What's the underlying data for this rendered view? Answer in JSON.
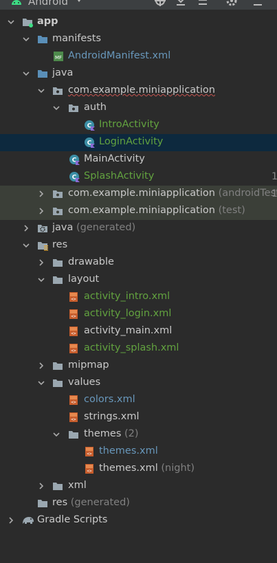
{
  "toolbar": {
    "view_name": "Android",
    "icons": [
      "android-icon",
      "locate-icon",
      "collapse-all-icon",
      "expand-all-icon",
      "gear-icon",
      "hide-icon"
    ]
  },
  "tree": {
    "app": "app",
    "manifests": "manifests",
    "android_manifest": "AndroidManifest.xml",
    "java": "java",
    "package_main": "com.example.miniapplication",
    "auth": "auth",
    "intro_activity": "IntroActivity",
    "login_activity": "LoginActivity",
    "main_activity": "MainActivity",
    "splash_activity": "SplashActivity",
    "package_android_test": "com.example.miniapplication",
    "android_test_hint": "(androidTest",
    "package_test": "com.example.miniapplication",
    "test_hint": "(test)",
    "java_generated": "java",
    "java_generated_hint": "(generated)",
    "res": "res",
    "drawable": "drawable",
    "layout": "layout",
    "activity_intro": "activity_intro.xml",
    "activity_login": "activity_login.xml",
    "activity_main": "activity_main.xml",
    "activity_splash": "activity_splash.xml",
    "mipmap": "mipmap",
    "values": "values",
    "colors": "colors.xml",
    "strings": "strings.xml",
    "themes": "themes",
    "themes_count": "(2)",
    "themes_xml": "themes.xml",
    "themes_night_xml": "themes.xml",
    "night_hint": "(night)",
    "xml": "xml",
    "res_generated": "res",
    "res_generated_hint": "(generated)",
    "gradle_scripts": "Gradle Scripts"
  },
  "gutter": [
    "1",
    "1"
  ],
  "colors": {
    "background": "#2b2b2b",
    "selection": "#0d293e",
    "modified_green": "#62a23f",
    "changed_blue": "#6897bb",
    "hint_gray": "#808080",
    "folder_blue": "#5a8fb8"
  }
}
